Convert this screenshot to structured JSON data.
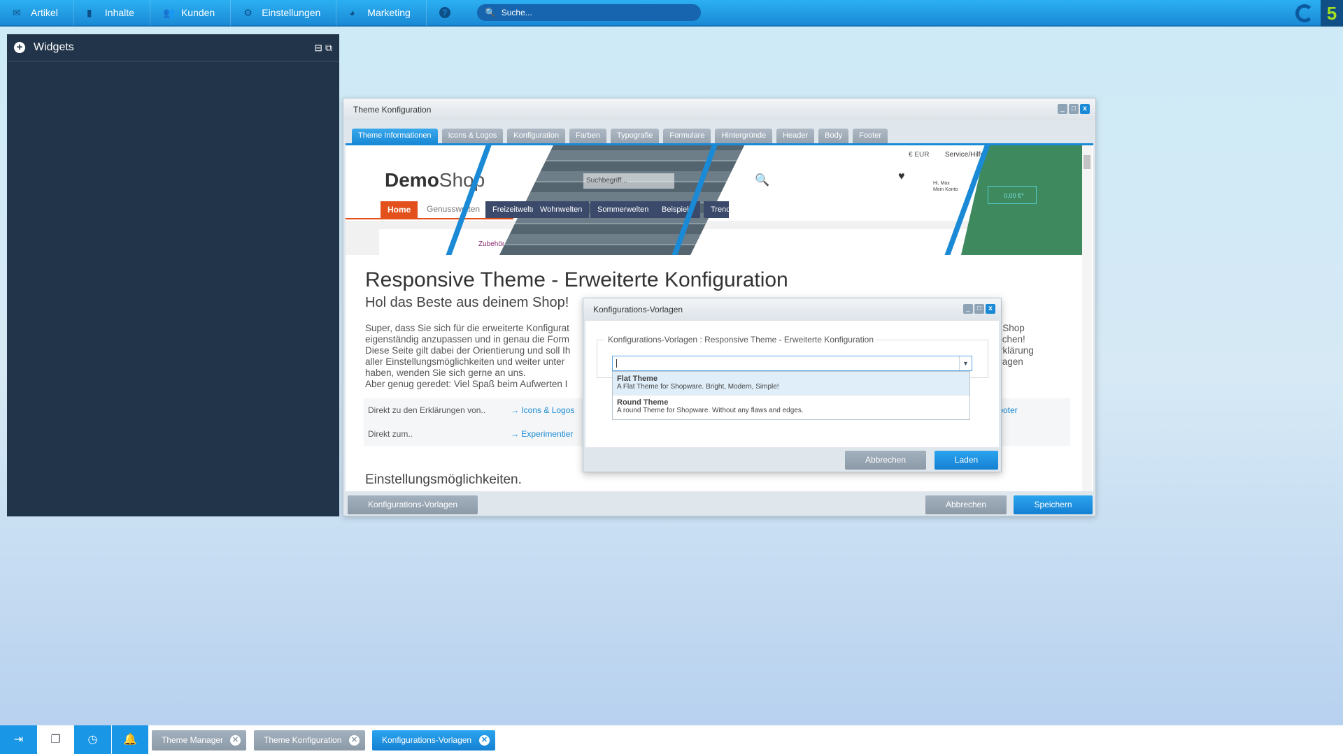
{
  "topbar": {
    "items": [
      {
        "label": "Artikel",
        "icon": "inbox-icon"
      },
      {
        "label": "Inhalte",
        "icon": "document-icon"
      },
      {
        "label": "Kunden",
        "icon": "users-icon"
      },
      {
        "label": "Einstellungen",
        "icon": "gear-icon"
      },
      {
        "label": "Marketing",
        "icon": "pie-chart-icon"
      }
    ],
    "help": "?",
    "search_placeholder": "Suche...",
    "brand_digit": "5"
  },
  "widgets": {
    "title": "Widgets"
  },
  "theme_window": {
    "title": "Theme Konfiguration",
    "tabs": [
      "Theme Informationen",
      "Icons & Logos",
      "Konfiguration",
      "Farben",
      "Typografie",
      "Formulare",
      "Hintergründe",
      "Header",
      "Body",
      "Footer"
    ],
    "preview": {
      "logo_bold": "Demo",
      "logo_light": "Shop",
      "search": "Suchbegriff...",
      "currency": "€ EUR",
      "service": "Service/Hilfe",
      "account_name": "Hi, Max",
      "account_sub": "Mein Konto",
      "cart": "0,00 €*",
      "nav": [
        "Home",
        "Genusswelten",
        "Freizeitwelten",
        "Wohnwelten",
        "Sommerwelten",
        "Beispiele",
        "Trends"
      ],
      "sub": "Zubehör"
    },
    "heading": "Responsive Theme - Erweiterte Konfiguration",
    "subheading": "Hol das Beste aus deinem Shop!",
    "para_left": [
      "Super, dass Sie sich für die erweiterte Konfigurat",
      "eigenständig anzupassen und in genau die Form",
      "Diese Seite gilt dabei der Orientierung und soll Ih",
      "aller Einstellungsmöglichkeiten und weiter unter",
      "haben, wenden Sie sich gerne an uns.",
      "Aber genug geredet: Viel Spaß beim Aufwerten I"
    ],
    "para_right": [
      "n Shop",
      "rsprochen!",
      "Erklärung",
      "ch Fragen"
    ],
    "links": {
      "row1_label": "Direkt zu den Erklärungen von..",
      "row1_link": "Icons & Logos",
      "row1_right": "Footer",
      "row2_label": "Direkt zum..",
      "row2_link": "Experimentier"
    },
    "section": "Einstellungsmöglichkeiten.",
    "btn_templates": "Konfigurations-Vorlagen",
    "btn_cancel": "Abbrechen",
    "btn_save": "Speichern"
  },
  "dialog": {
    "title": "Konfigurations-Vorlagen",
    "legend": "Konfigurations-Vorlagen : Responsive Theme - Erweiterte Konfiguration",
    "combo_value": "",
    "options": [
      {
        "name": "Flat Theme",
        "desc": "A Flat Theme for Shopware. Bright, Modern, Simple!",
        "selected": true
      },
      {
        "name": "Round Theme",
        "desc": "A round Theme for Shopware. Without any flaws and edges."
      }
    ],
    "btn_cancel": "Abbrechen",
    "btn_load": "Laden"
  },
  "taskbar": {
    "tasks": [
      {
        "label": "Theme Manager",
        "active": false
      },
      {
        "label": "Theme Konfiguration",
        "active": false
      },
      {
        "label": "Konfigurations-Vorlagen",
        "active": true
      }
    ]
  },
  "colors": {
    "accent": "#1a8ad6",
    "panel": "#22344a",
    "shop_orange": "#e2511c"
  }
}
